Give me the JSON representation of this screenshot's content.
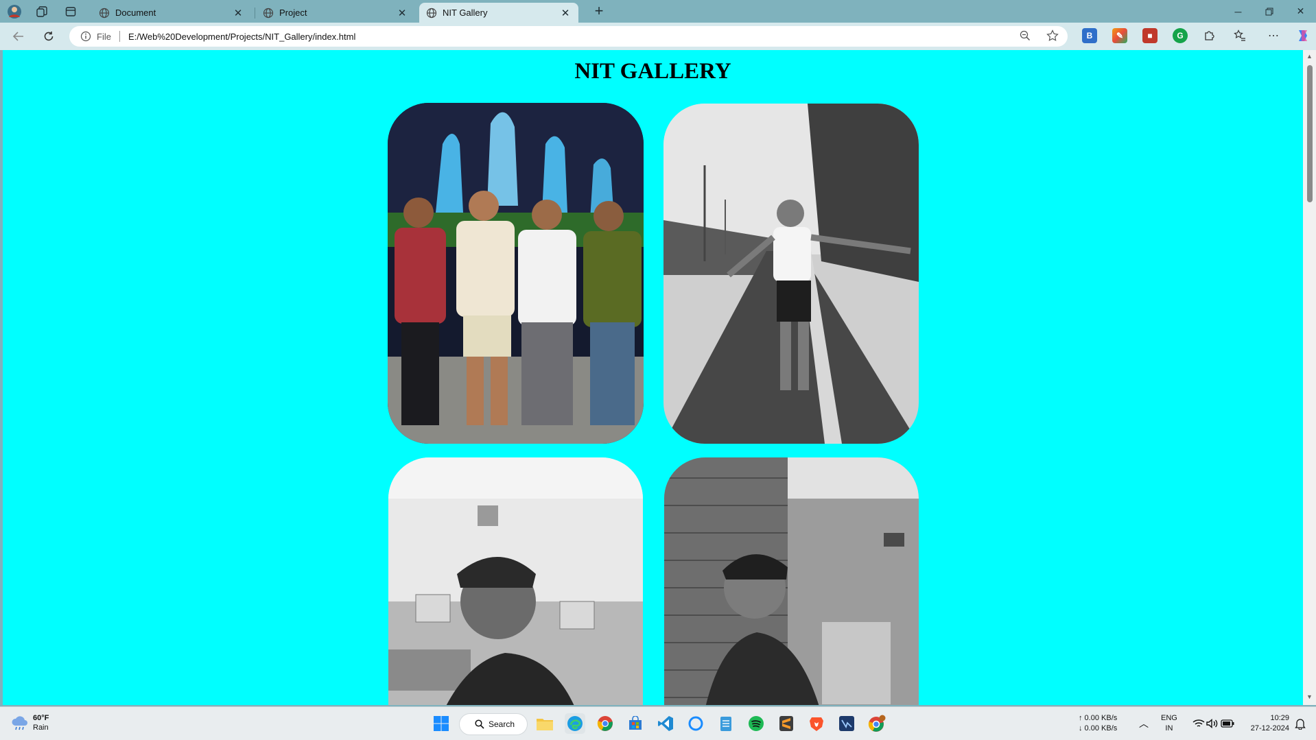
{
  "browser": {
    "tabs": [
      {
        "title": "Document",
        "active": false
      },
      {
        "title": "Project",
        "active": false
      },
      {
        "title": "NIT Gallery",
        "active": true
      }
    ],
    "address": {
      "scheme_label": "File",
      "url": "E:/Web%20Development/Projects/NIT_Gallery/index.html"
    },
    "extensions": [
      "bing-icon",
      "paint-icon",
      "recorder-icon",
      "grammarly-icon"
    ],
    "colors": {
      "frame": "#7fb2bd",
      "toolbar": "#d6e9ed"
    }
  },
  "page": {
    "title": "NIT GALLERY",
    "background": "#00ffff",
    "photos": [
      {
        "name": "photo-group-fountain",
        "description_icon": "photo-icon",
        "tone": "color"
      },
      {
        "name": "photo-rain-road",
        "description_icon": "photo-icon",
        "tone": "grayscale"
      },
      {
        "name": "photo-computer-lab",
        "description_icon": "photo-icon",
        "tone": "grayscale"
      },
      {
        "name": "photo-brick-wall",
        "description_icon": "photo-icon",
        "tone": "grayscale"
      }
    ]
  },
  "taskbar": {
    "weather": {
      "temp": "60°F",
      "condition": "Rain"
    },
    "search_label": "Search",
    "network": {
      "up": "↑ 0.00 KB/s",
      "down": "↓ 0.00 KB/s"
    },
    "language": {
      "lang": "ENG",
      "region": "IN"
    },
    "clock": {
      "time": "10:29",
      "date": "27-12-2024"
    }
  }
}
